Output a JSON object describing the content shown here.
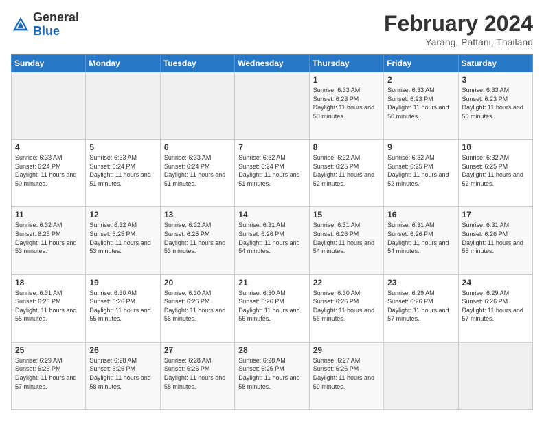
{
  "header": {
    "logo_general": "General",
    "logo_blue": "Blue",
    "month_year": "February 2024",
    "location": "Yarang, Pattani, Thailand"
  },
  "days_of_week": [
    "Sunday",
    "Monday",
    "Tuesday",
    "Wednesday",
    "Thursday",
    "Friday",
    "Saturday"
  ],
  "weeks": [
    [
      {
        "num": "",
        "info": ""
      },
      {
        "num": "",
        "info": ""
      },
      {
        "num": "",
        "info": ""
      },
      {
        "num": "",
        "info": ""
      },
      {
        "num": "1",
        "info": "Sunrise: 6:33 AM\nSunset: 6:23 PM\nDaylight: 11 hours\nand 50 minutes."
      },
      {
        "num": "2",
        "info": "Sunrise: 6:33 AM\nSunset: 6:23 PM\nDaylight: 11 hours\nand 50 minutes."
      },
      {
        "num": "3",
        "info": "Sunrise: 6:33 AM\nSunset: 6:23 PM\nDaylight: 11 hours\nand 50 minutes."
      }
    ],
    [
      {
        "num": "4",
        "info": "Sunrise: 6:33 AM\nSunset: 6:24 PM\nDaylight: 11 hours\nand 50 minutes."
      },
      {
        "num": "5",
        "info": "Sunrise: 6:33 AM\nSunset: 6:24 PM\nDaylight: 11 hours\nand 51 minutes."
      },
      {
        "num": "6",
        "info": "Sunrise: 6:33 AM\nSunset: 6:24 PM\nDaylight: 11 hours\nand 51 minutes."
      },
      {
        "num": "7",
        "info": "Sunrise: 6:32 AM\nSunset: 6:24 PM\nDaylight: 11 hours\nand 51 minutes."
      },
      {
        "num": "8",
        "info": "Sunrise: 6:32 AM\nSunset: 6:25 PM\nDaylight: 11 hours\nand 52 minutes."
      },
      {
        "num": "9",
        "info": "Sunrise: 6:32 AM\nSunset: 6:25 PM\nDaylight: 11 hours\nand 52 minutes."
      },
      {
        "num": "10",
        "info": "Sunrise: 6:32 AM\nSunset: 6:25 PM\nDaylight: 11 hours\nand 52 minutes."
      }
    ],
    [
      {
        "num": "11",
        "info": "Sunrise: 6:32 AM\nSunset: 6:25 PM\nDaylight: 11 hours\nand 53 minutes."
      },
      {
        "num": "12",
        "info": "Sunrise: 6:32 AM\nSunset: 6:25 PM\nDaylight: 11 hours\nand 53 minutes."
      },
      {
        "num": "13",
        "info": "Sunrise: 6:32 AM\nSunset: 6:25 PM\nDaylight: 11 hours\nand 53 minutes."
      },
      {
        "num": "14",
        "info": "Sunrise: 6:31 AM\nSunset: 6:26 PM\nDaylight: 11 hours\nand 54 minutes."
      },
      {
        "num": "15",
        "info": "Sunrise: 6:31 AM\nSunset: 6:26 PM\nDaylight: 11 hours\nand 54 minutes."
      },
      {
        "num": "16",
        "info": "Sunrise: 6:31 AM\nSunset: 6:26 PM\nDaylight: 11 hours\nand 54 minutes."
      },
      {
        "num": "17",
        "info": "Sunrise: 6:31 AM\nSunset: 6:26 PM\nDaylight: 11 hours\nand 55 minutes."
      }
    ],
    [
      {
        "num": "18",
        "info": "Sunrise: 6:31 AM\nSunset: 6:26 PM\nDaylight: 11 hours\nand 55 minutes."
      },
      {
        "num": "19",
        "info": "Sunrise: 6:30 AM\nSunset: 6:26 PM\nDaylight: 11 hours\nand 55 minutes."
      },
      {
        "num": "20",
        "info": "Sunrise: 6:30 AM\nSunset: 6:26 PM\nDaylight: 11 hours\nand 56 minutes."
      },
      {
        "num": "21",
        "info": "Sunrise: 6:30 AM\nSunset: 6:26 PM\nDaylight: 11 hours\nand 56 minutes."
      },
      {
        "num": "22",
        "info": "Sunrise: 6:30 AM\nSunset: 6:26 PM\nDaylight: 11 hours\nand 56 minutes."
      },
      {
        "num": "23",
        "info": "Sunrise: 6:29 AM\nSunset: 6:26 PM\nDaylight: 11 hours\nand 57 minutes."
      },
      {
        "num": "24",
        "info": "Sunrise: 6:29 AM\nSunset: 6:26 PM\nDaylight: 11 hours\nand 57 minutes."
      }
    ],
    [
      {
        "num": "25",
        "info": "Sunrise: 6:29 AM\nSunset: 6:26 PM\nDaylight: 11 hours\nand 57 minutes."
      },
      {
        "num": "26",
        "info": "Sunrise: 6:28 AM\nSunset: 6:26 PM\nDaylight: 11 hours\nand 58 minutes."
      },
      {
        "num": "27",
        "info": "Sunrise: 6:28 AM\nSunset: 6:26 PM\nDaylight: 11 hours\nand 58 minutes."
      },
      {
        "num": "28",
        "info": "Sunrise: 6:28 AM\nSunset: 6:26 PM\nDaylight: 11 hours\nand 58 minutes."
      },
      {
        "num": "29",
        "info": "Sunrise: 6:27 AM\nSunset: 6:26 PM\nDaylight: 11 hours\nand 59 minutes."
      },
      {
        "num": "",
        "info": ""
      },
      {
        "num": "",
        "info": ""
      }
    ]
  ]
}
